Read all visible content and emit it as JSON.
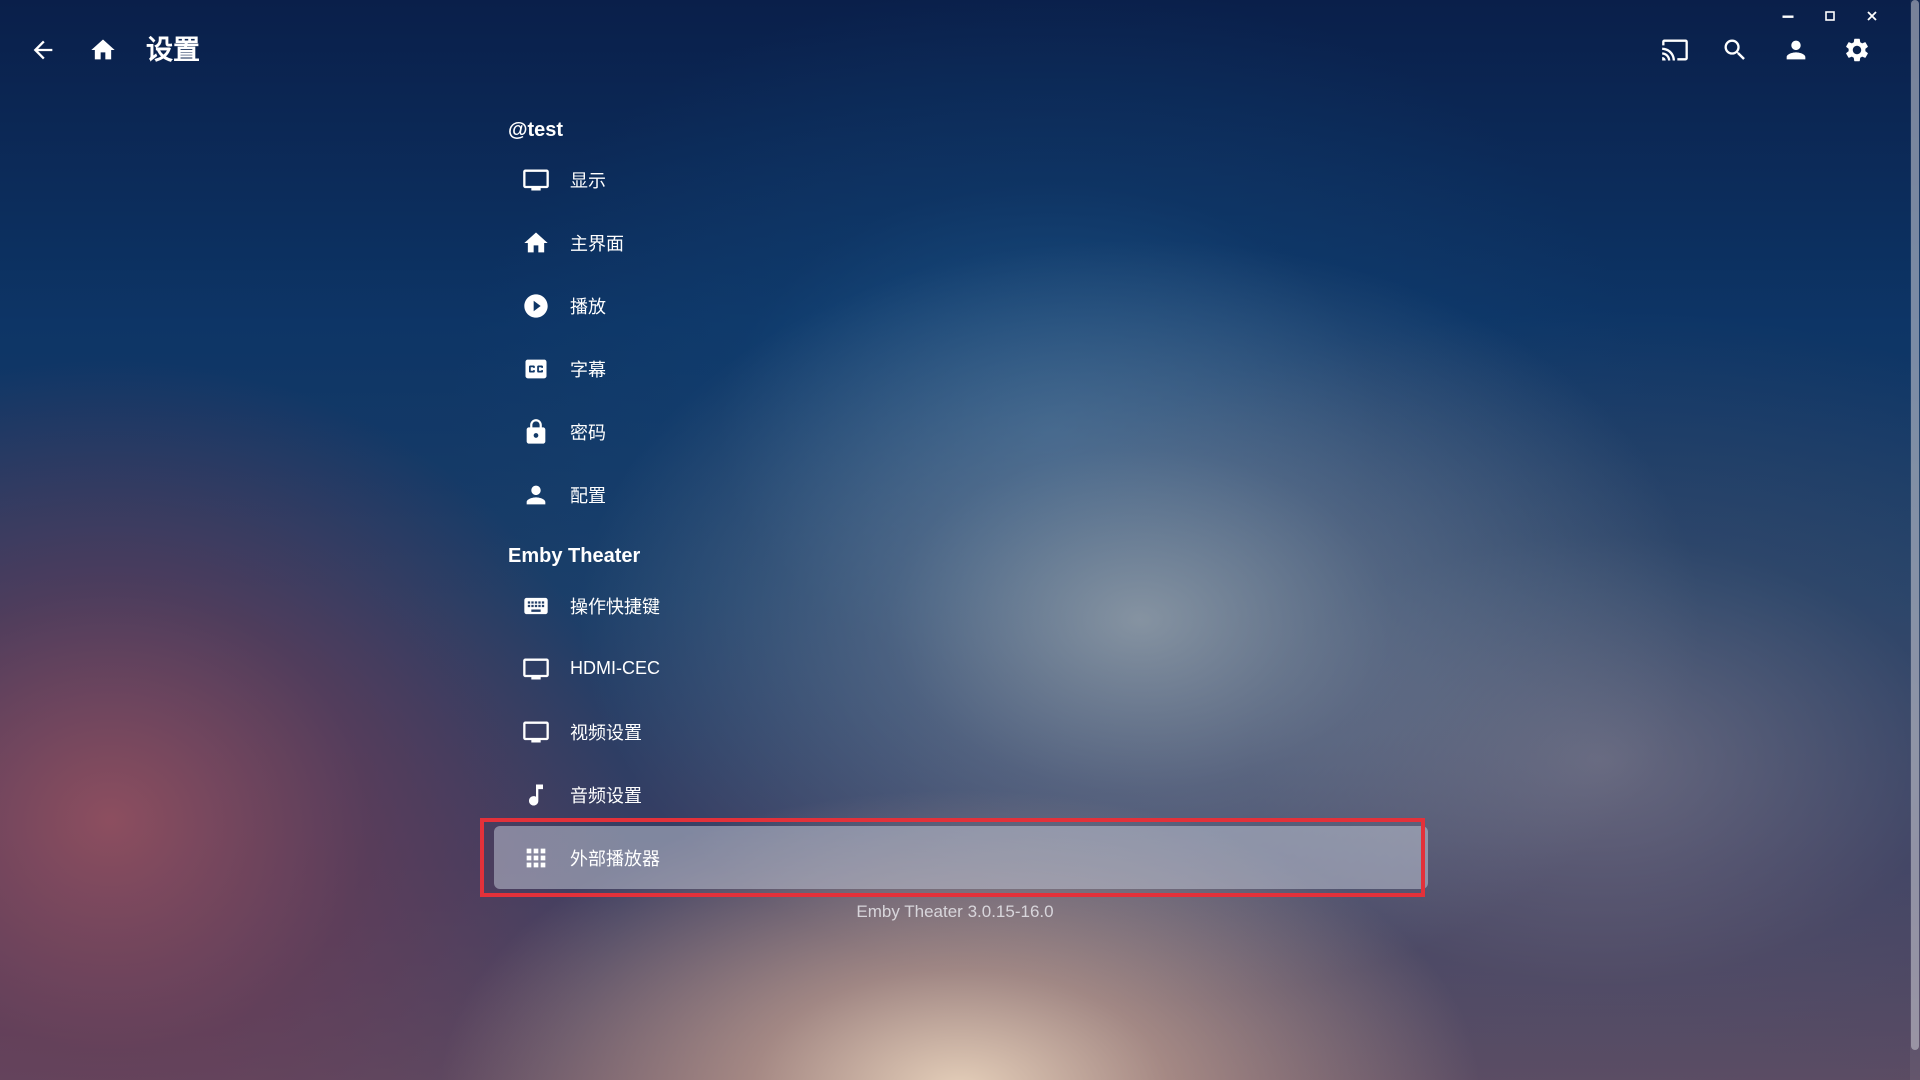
{
  "window": {
    "minimize_icon": "minimize-icon",
    "maximize_icon": "maximize-icon",
    "close_icon": "close-icon"
  },
  "header": {
    "title": "设置",
    "back_icon": "arrow-left-icon",
    "home_icon": "home-icon",
    "actions": [
      "cast-icon",
      "search-icon",
      "user-icon",
      "gear-icon"
    ]
  },
  "sections": [
    {
      "title": "@test",
      "items": [
        {
          "label": "显示",
          "icon": "monitor-icon"
        },
        {
          "label": "主界面",
          "icon": "home-icon"
        },
        {
          "label": "播放",
          "icon": "play-circle-icon"
        },
        {
          "label": "字幕",
          "icon": "closed-caption-icon"
        },
        {
          "label": "密码",
          "icon": "lock-icon"
        },
        {
          "label": "配置",
          "icon": "person-icon"
        }
      ]
    },
    {
      "title": "Emby Theater",
      "items": [
        {
          "label": "操作快捷键",
          "icon": "keyboard-icon"
        },
        {
          "label": "HDMI-CEC",
          "icon": "monitor-icon"
        },
        {
          "label": "视频设置",
          "icon": "monitor-icon"
        },
        {
          "label": "音频设置",
          "icon": "music-note-icon"
        },
        {
          "label": "外部播放器",
          "icon": "grid-icon",
          "selected": true
        }
      ]
    }
  ],
  "footer": {
    "version": "Emby Theater 3.0.15-16.0"
  },
  "colors": {
    "highlight_border": "#e3313a",
    "selected_bg": "rgba(190,195,210,0.55)"
  }
}
